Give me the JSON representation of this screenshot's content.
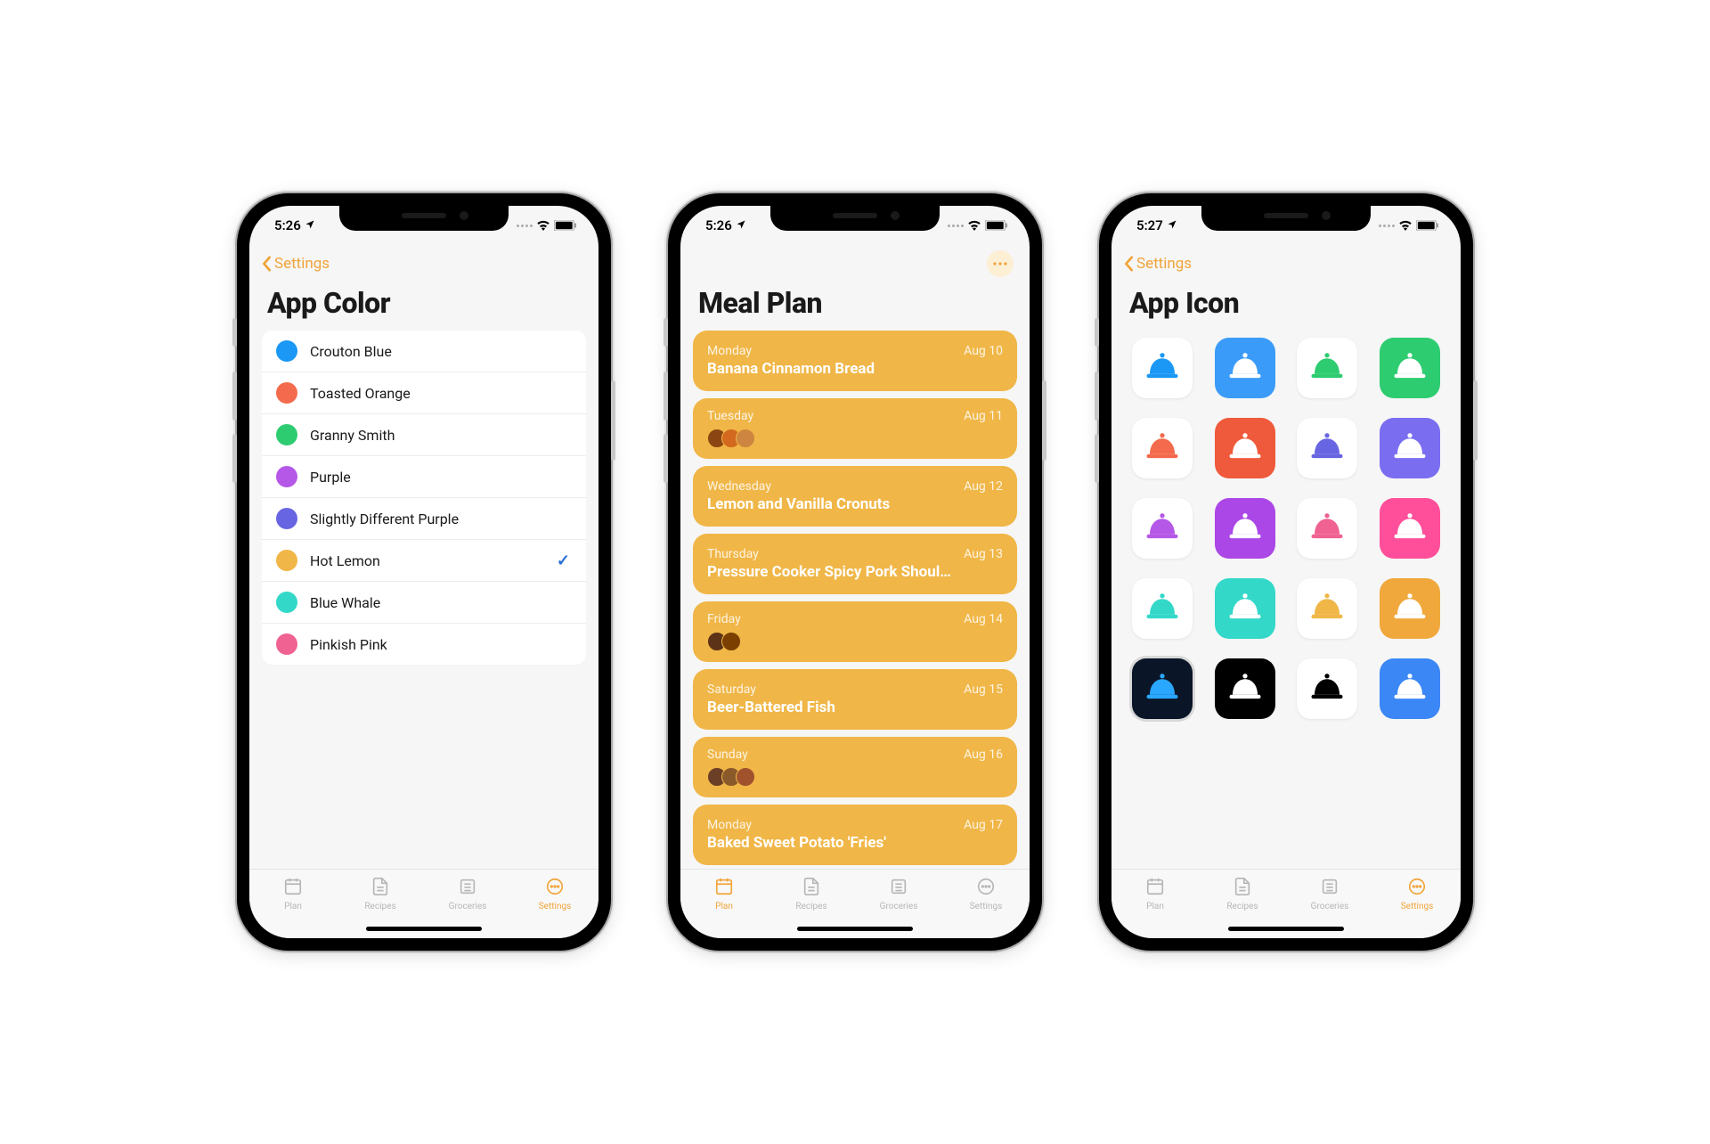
{
  "phone1": {
    "status_time": "5:26",
    "back_label": "Settings",
    "title": "App Color",
    "colors": [
      {
        "label": "Crouton Blue",
        "hex": "#1b98f5",
        "selected": false
      },
      {
        "label": "Toasted Orange",
        "hex": "#f36b4c",
        "selected": false
      },
      {
        "label": "Granny Smith",
        "hex": "#2ecc71",
        "selected": false
      },
      {
        "label": "Purple",
        "hex": "#b558e8",
        "selected": false
      },
      {
        "label": "Slightly Different Purple",
        "hex": "#6865e2",
        "selected": false
      },
      {
        "label": "Hot Lemon",
        "hex": "#f0b647",
        "selected": true
      },
      {
        "label": "Blue Whale",
        "hex": "#34d8c8",
        "selected": false
      },
      {
        "label": "Pinkish Pink",
        "hex": "#f06292",
        "selected": false
      }
    ],
    "tabs": [
      {
        "label": "Plan",
        "active": false
      },
      {
        "label": "Recipes",
        "active": false
      },
      {
        "label": "Groceries",
        "active": false
      },
      {
        "label": "Settings",
        "active": true
      }
    ]
  },
  "phone2": {
    "status_time": "5:26",
    "title": "Meal Plan",
    "meals": [
      {
        "day": "Monday",
        "date": "Aug 10",
        "title": "Banana Cinnamon Bread",
        "thumbs": []
      },
      {
        "day": "Tuesday",
        "date": "Aug 11",
        "title": "",
        "thumbs": [
          "#8b4513",
          "#d2691e",
          "#cd853f"
        ]
      },
      {
        "day": "Wednesday",
        "date": "Aug 12",
        "title": "Lemon and Vanilla Cronuts",
        "thumbs": []
      },
      {
        "day": "Thursday",
        "date": "Aug 13",
        "title": "Pressure Cooker Spicy Pork Shoul…",
        "thumbs": []
      },
      {
        "day": "Friday",
        "date": "Aug 14",
        "title": "",
        "thumbs": [
          "#5c3317",
          "#7b3f00"
        ]
      },
      {
        "day": "Saturday",
        "date": "Aug 15",
        "title": "Beer-Battered Fish",
        "thumbs": []
      },
      {
        "day": "Sunday",
        "date": "Aug 16",
        "title": "",
        "thumbs": [
          "#6b3e26",
          "#8b5a2b",
          "#a0522d"
        ]
      },
      {
        "day": "Monday",
        "date": "Aug 17",
        "title": "Baked Sweet Potato 'Fries'",
        "thumbs": []
      }
    ],
    "tabs": [
      {
        "label": "Plan",
        "active": true
      },
      {
        "label": "Recipes",
        "active": false
      },
      {
        "label": "Groceries",
        "active": false
      },
      {
        "label": "Settings",
        "active": false
      }
    ]
  },
  "phone3": {
    "status_time": "5:27",
    "back_label": "Settings",
    "title": "App Icon",
    "icons": [
      {
        "type": "outline",
        "fg": "#1b98f5",
        "bg": "white"
      },
      {
        "type": "filled",
        "fg": "#ffffff",
        "bg": "#3b9bf8"
      },
      {
        "type": "outline",
        "fg": "#2ecc71",
        "bg": "white"
      },
      {
        "type": "filled",
        "fg": "#ffffff",
        "bg": "#2ecc71"
      },
      {
        "type": "outline",
        "fg": "#f36b4c",
        "bg": "white"
      },
      {
        "type": "filled",
        "fg": "#ffffff",
        "bg": "#ee5a3b"
      },
      {
        "type": "outline",
        "fg": "#6865e2",
        "bg": "white"
      },
      {
        "type": "filled",
        "fg": "#ffffff",
        "bg": "#7a6df0"
      },
      {
        "type": "outline",
        "fg": "#b558e8",
        "bg": "white"
      },
      {
        "type": "filled",
        "fg": "#ffffff",
        "bg": "#ab47e6"
      },
      {
        "type": "outline",
        "fg": "#f06292",
        "bg": "white"
      },
      {
        "type": "filled",
        "fg": "#ffffff",
        "bg": "#ff4f9a"
      },
      {
        "type": "outline",
        "fg": "#34d8c8",
        "bg": "white"
      },
      {
        "type": "filled",
        "fg": "#ffffff",
        "bg": "#34d8c8"
      },
      {
        "type": "outline",
        "fg": "#f0b647",
        "bg": "white"
      },
      {
        "type": "filled",
        "fg": "#ffffff",
        "bg": "#f0a83c"
      },
      {
        "type": "neon",
        "fg": "#2aa7ff",
        "bg": "#0a1628",
        "selected": true
      },
      {
        "type": "filled",
        "fg": "#ffffff",
        "bg": "#000000"
      },
      {
        "type": "outline",
        "fg": "#000000",
        "bg": "white"
      },
      {
        "type": "blueprint",
        "fg": "#ffffff",
        "bg": "#3b87f5"
      }
    ],
    "tabs": [
      {
        "label": "Plan",
        "active": false
      },
      {
        "label": "Recipes",
        "active": false
      },
      {
        "label": "Groceries",
        "active": false
      },
      {
        "label": "Settings",
        "active": true
      }
    ]
  }
}
